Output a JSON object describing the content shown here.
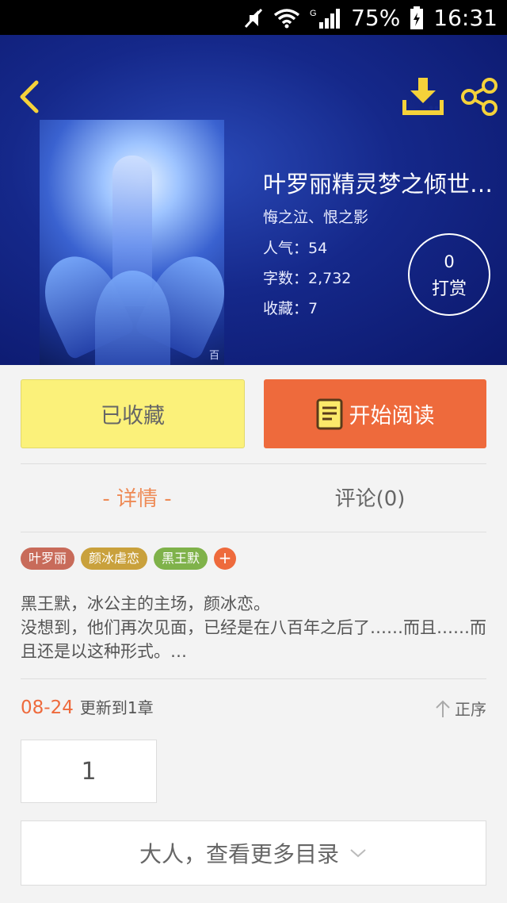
{
  "status": {
    "battery": "75%",
    "time": "16:31",
    "network": "G"
  },
  "book": {
    "title": "叶罗丽精灵梦之倾世…",
    "author": "悔之泣、恨之影",
    "popularity": "人气：54",
    "wordcount": "字数：2,732",
    "favorites": "收藏：7",
    "cover_watermark": "百"
  },
  "tip": {
    "count": "0",
    "label": "打赏"
  },
  "actions": {
    "favorited": "已收藏",
    "start_read": "开始阅读"
  },
  "tabs": {
    "detail": "- 详情 -",
    "comments": "评论(0)"
  },
  "tags": [
    {
      "label": "叶罗丽",
      "color": "#c86b5a"
    },
    {
      "label": "颜冰虐恋",
      "color": "#c9a13c"
    },
    {
      "label": "黑王默",
      "color": "#7fb24a"
    }
  ],
  "tag_add": "+",
  "description": {
    "line1": "黑王默，冰公主的主场，颜冰恋。",
    "line2": "没想到，他们再次见面，已经是在八百年之后了……而且……而且还是以这种形式。…"
  },
  "update": {
    "date": "08-24",
    "text": "更新到1章",
    "order": "正序"
  },
  "chapter": "1",
  "more": "大人，查看更多目录"
}
